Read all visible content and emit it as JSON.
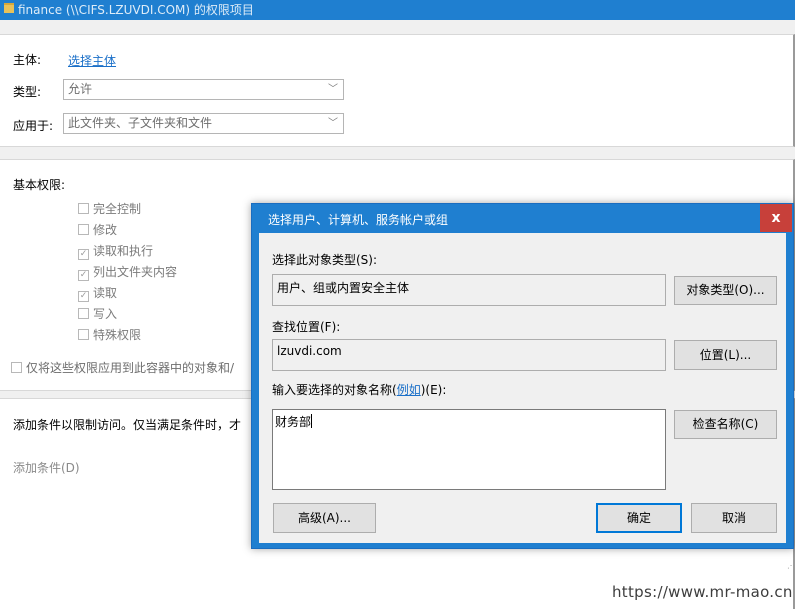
{
  "window": {
    "title": "finance (\\\\CIFS.LZUVDI.COM) 的权限项目"
  },
  "principal": {
    "label": "主体:",
    "link": "选择主体"
  },
  "type": {
    "label": "类型:",
    "value": "允许"
  },
  "applies_to": {
    "label": "应用于:",
    "value": "此文件夹、子文件夹和文件"
  },
  "basic_permissions": {
    "label": "基本权限:",
    "items": [
      {
        "label": "完全控制",
        "checked": false
      },
      {
        "label": "修改",
        "checked": false
      },
      {
        "label": "读取和执行",
        "checked": true
      },
      {
        "label": "列出文件夹内容",
        "checked": true
      },
      {
        "label": "读取",
        "checked": true
      },
      {
        "label": "写入",
        "checked": false
      },
      {
        "label": "特殊权限",
        "checked": false
      }
    ],
    "apply_only_label": "仅将这些权限应用到此容器中的对象和/"
  },
  "conditions": {
    "description": "添加条件以限制访问。仅当满足条件时，才",
    "add_link": "添加条件(D)"
  },
  "dialog": {
    "title": "选择用户、计算机、服务帐户或组",
    "close_symbol": "x",
    "object_type_label": "选择此对象类型(S):",
    "object_type_value": "用户、组或内置安全主体",
    "object_type_button": "对象类型(O)...",
    "location_label": "查找位置(F):",
    "location_value": "lzuvdi.com",
    "location_button": "位置(L)...",
    "names_label_prefix": "输入要选择的对象名称(",
    "names_label_link": "例如",
    "names_label_suffix": ")(E):",
    "names_value": "财务部",
    "check_names_button": "检查名称(C)",
    "advanced_button": "高级(A)...",
    "ok_button": "确定",
    "cancel_button": "取消"
  },
  "watermark": "https://www.mr-mao.cn"
}
